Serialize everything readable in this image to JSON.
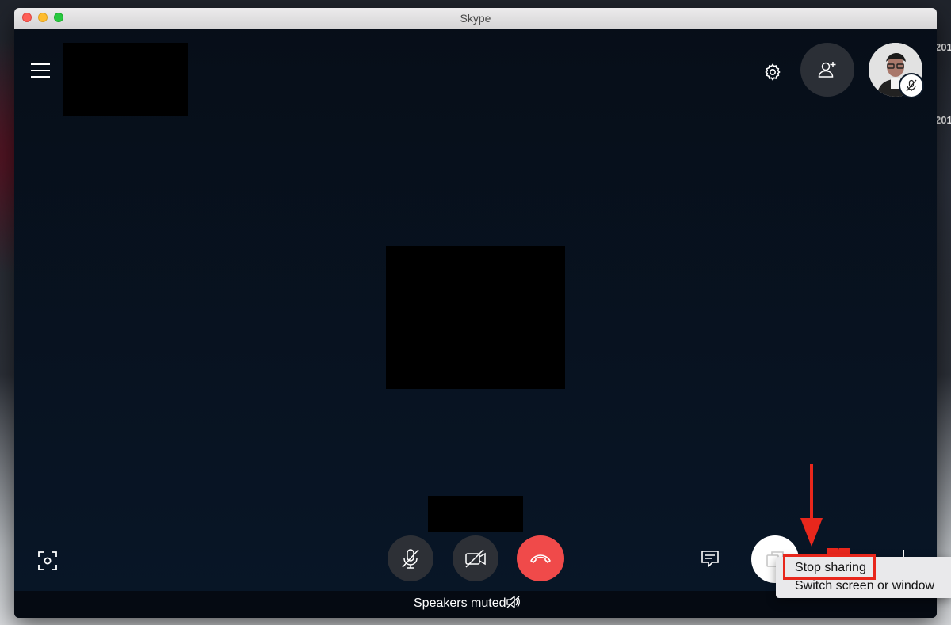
{
  "window": {
    "title": "Skype"
  },
  "desktop": {
    "fragment_1": "201",
    "fragment_2": "201"
  },
  "call": {
    "status_text": "Speakers muted",
    "controls": {
      "mute": "microphone-off-icon",
      "video": "video-off-icon",
      "hangup": "hang-up-icon"
    }
  },
  "share_menu": {
    "items": [
      {
        "label": "Stop sharing"
      },
      {
        "label": "Switch screen or window"
      }
    ]
  },
  "colors": {
    "hangup_red": "#f04a4a",
    "annotation_red": "#e8271c",
    "call_background": "#081627"
  }
}
